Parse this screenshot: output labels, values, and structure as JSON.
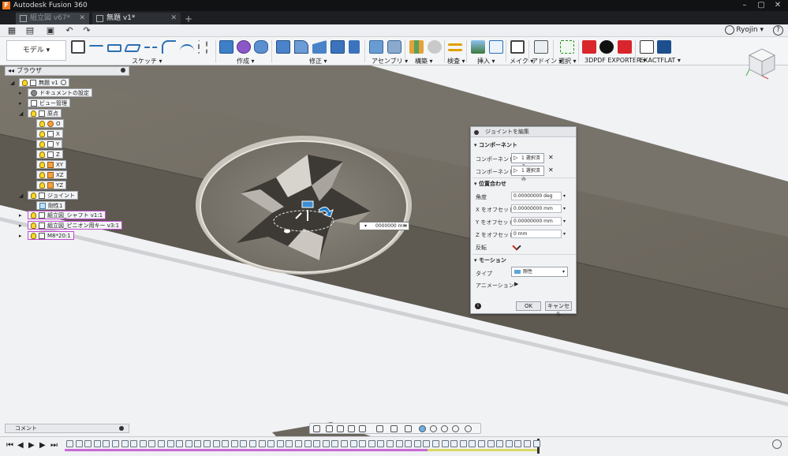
{
  "window": {
    "title": "Autodesk Fusion 360",
    "app_icon": "F"
  },
  "tabs": [
    {
      "label": "組立図 v67*",
      "active": false
    },
    {
      "label": "無題 v1*",
      "active": true
    }
  ],
  "user": {
    "name": "Ryojin ▾"
  },
  "workspace": {
    "label": "モデル ▾"
  },
  "ribbon_groups": [
    {
      "label": "スケッチ ▾"
    },
    {
      "label": "作成 ▾"
    },
    {
      "label": "修正 ▾"
    },
    {
      "label": "アセンブリ ▾"
    },
    {
      "label": "構築 ▾"
    },
    {
      "label": "検査 ▾"
    },
    {
      "label": "挿入 ▾"
    },
    {
      "label": "メイク ▾"
    },
    {
      "label": "アドイン ▾"
    },
    {
      "label": "選択 ▾"
    },
    {
      "label": "3DPDF EXPORTER ▾"
    },
    {
      "label": "EXACTFLAT ▾"
    }
  ],
  "browser": {
    "title": "ブラウザ",
    "items": [
      {
        "label": "無題 v1"
      },
      {
        "label": "ドキュメントの設定"
      },
      {
        "label": "ビュー管理"
      },
      {
        "label": "原点"
      },
      {
        "label": "O"
      },
      {
        "label": "X"
      },
      {
        "label": "Y"
      },
      {
        "label": "Z"
      },
      {
        "label": "XY"
      },
      {
        "label": "XZ"
      },
      {
        "label": "YZ"
      },
      {
        "label": "ジョイント"
      },
      {
        "label": "剛性1"
      },
      {
        "label": "組立図_シャフト v1:1"
      },
      {
        "label": "組立図_ピニオン用キー v3:1"
      },
      {
        "label": "M8*20:1"
      }
    ]
  },
  "dialog": {
    "title": "ジョイントを編集",
    "section_component": "コンポーネント",
    "component1_label": "コンポーネント 1",
    "component1_value": "1 選択済み",
    "component2_label": "コンポーネント 2",
    "component2_value": "1 選択済み",
    "section_position": "位置合わせ",
    "angle_label": "角度",
    "angle_value": "0.00000000 deg",
    "xoffset_label": "X をオフセット",
    "xoffset_value": "0.00000000 mm",
    "yoffset_label": "Y をオフセット",
    "yoffset_value": "0.00000000 mm",
    "zoffset_label": "Z をオフセット",
    "zoffset_value": "0 mm",
    "flip_label": "反転",
    "section_motion": "モーション",
    "type_label": "タイプ",
    "type_value": "剛性",
    "animation_label": "アニメーション",
    "ok_label": "OK",
    "cancel_label": "キャンセル"
  },
  "canvas_input": {
    "value": "0000000 mm"
  },
  "comments": {
    "label": "コメント"
  },
  "colors": {
    "accent_blue": "#2d8fd5",
    "pdf_red": "#d8262c",
    "bulb_yellow": "#ffd62a",
    "model_gray": "#6f6a61"
  }
}
